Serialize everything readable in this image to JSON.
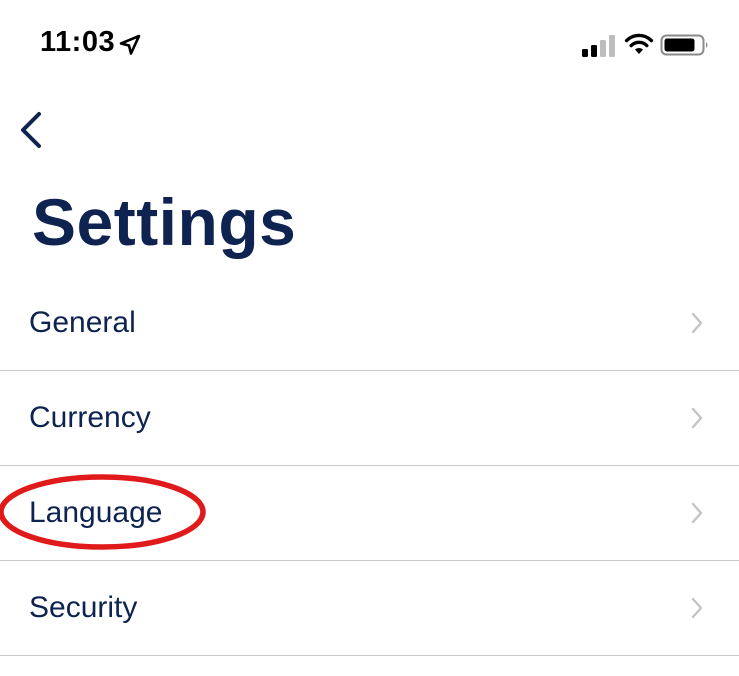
{
  "status_bar": {
    "time": "11:03",
    "icons": [
      "location-arrow-icon",
      "cellular-signal-icon",
      "wifi-icon",
      "battery-icon"
    ]
  },
  "navigation": {
    "back_icon": "chevron-left-icon"
  },
  "page": {
    "title": "Settings"
  },
  "settings": {
    "items": [
      {
        "label": "General"
      },
      {
        "label": "Currency"
      },
      {
        "label": "Language"
      },
      {
        "label": "Security"
      }
    ]
  },
  "annotation": {
    "highlighted_item": "Language",
    "color": "#e01a1a"
  },
  "colors": {
    "text_primary": "#0e2350",
    "divider": "#c9c9cc",
    "chevron": "#c4c4c8"
  }
}
